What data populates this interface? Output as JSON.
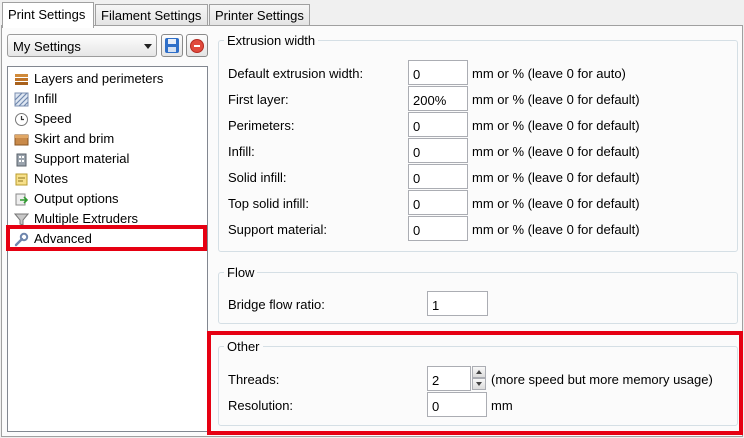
{
  "tabs": [
    {
      "label": "Print Settings",
      "active": true
    },
    {
      "label": "Filament Settings",
      "active": false
    },
    {
      "label": "Printer Settings",
      "active": false
    }
  ],
  "preset": {
    "selected": "My Settings"
  },
  "tree": {
    "items": [
      {
        "label": "Layers and perimeters",
        "icon": "layers-icon"
      },
      {
        "label": "Infill",
        "icon": "infill-icon"
      },
      {
        "label": "Speed",
        "icon": "clock-icon"
      },
      {
        "label": "Skirt and brim",
        "icon": "box-icon"
      },
      {
        "label": "Support material",
        "icon": "building-icon"
      },
      {
        "label": "Notes",
        "icon": "note-icon"
      },
      {
        "label": "Output options",
        "icon": "output-icon"
      },
      {
        "label": "Multiple Extruders",
        "icon": "funnel-icon"
      },
      {
        "label": "Advanced",
        "icon": "wrench-icon",
        "selected": true
      }
    ]
  },
  "extrusion_width": {
    "title": "Extrusion width",
    "rows": [
      {
        "label": "Default extrusion width:",
        "value": "0",
        "unit": "mm or % (leave 0 for auto)"
      },
      {
        "label": "First layer:",
        "value": "200%",
        "unit": "mm or % (leave 0 for default)"
      },
      {
        "label": "Perimeters:",
        "value": "0",
        "unit": "mm or % (leave 0 for default)"
      },
      {
        "label": "Infill:",
        "value": "0",
        "unit": "mm or % (leave 0 for default)"
      },
      {
        "label": "Solid infill:",
        "value": "0",
        "unit": "mm or % (leave 0 for default)"
      },
      {
        "label": "Top solid infill:",
        "value": "0",
        "unit": "mm or % (leave 0 for default)"
      },
      {
        "label": "Support material:",
        "value": "0",
        "unit": "mm or % (leave 0 for default)"
      }
    ]
  },
  "flow": {
    "title": "Flow",
    "bridge_label": "Bridge flow ratio:",
    "bridge_value": "1"
  },
  "other": {
    "title": "Other",
    "threads_label": "Threads:",
    "threads_value": "2",
    "threads_note": "(more speed but more memory usage)",
    "resolution_label": "Resolution:",
    "resolution_value": "0",
    "resolution_unit": "mm"
  },
  "colors": {
    "highlight": "#e60012",
    "panel_bg": "#fbfbfb"
  }
}
